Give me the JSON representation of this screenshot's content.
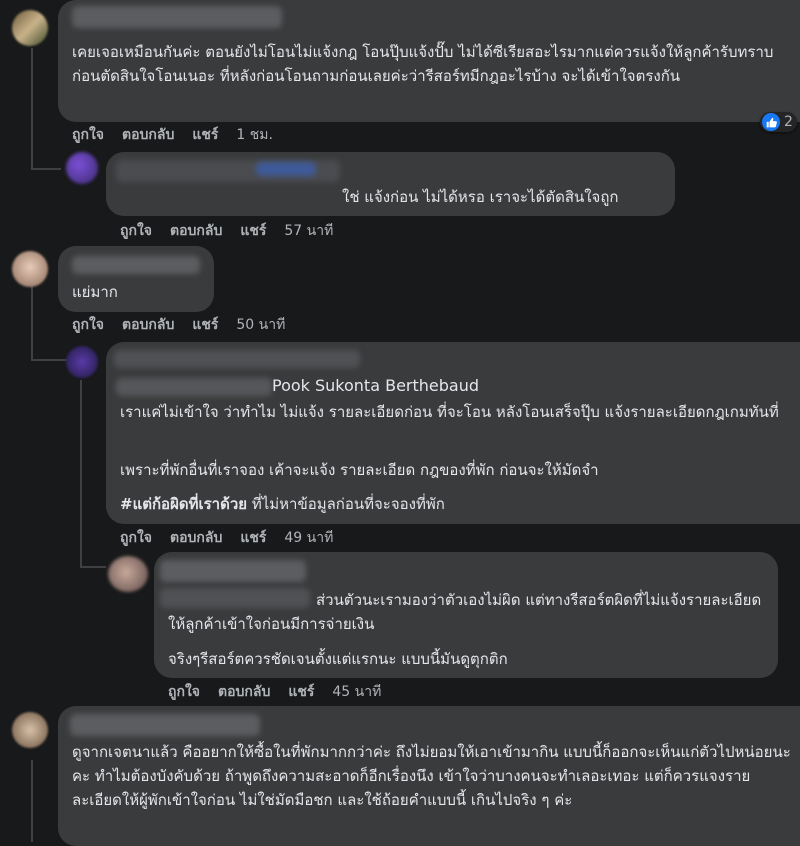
{
  "actions": {
    "like": "ถูกใจ",
    "reply": "ตอบกลับ",
    "share": "แชร์"
  },
  "comments": [
    {
      "text": "เคยเจอเหมือนกันค่ะ ตอนยังไม่โอนไม่แจ้งกฎ โอนปุ๊บแจ้งปั๊บ ไม่ได้ซีเรียสอะไรมากแต่ควรแจ้งให้ลูกค้ารับทราบก่อนตัดสินใจโอนเนอะ ที่หลังก่อนโอนถามก่อนเลยค่ะว่ารีสอร์ทมีกฎอะไรบ้าง จะได้เข้าใจตรงกัน",
      "time": "1 ชม.",
      "reaction_count": "2"
    },
    {
      "text": "ใช่ แจ้งก่อน ไม่ได้หรอ เราจะได้ตัดสินใจถูก",
      "time": "57 นาที"
    },
    {
      "text": "แย่มาก",
      "time": "50 นาที"
    },
    {
      "mention": "Pook Sukonta Berthebaud",
      "paragraph1": "เราแค่ไม่เข้าใจ ว่าทำไม ไม่แจ้ง รายละเอียดก่อน ที่จะโอน หลังโอนเสร็จปุ๊บ แจ้งรายละเอียดกฎเกมทันที่",
      "paragraph2": "เพราะที่พักอื่นที่เราจอง เค้าจะแจ้ง รายละเอียด กฎของที่พัก ก่อนจะให้มัดจำ",
      "hashtag": "#แต่ก้อผิดที่เราด้วย",
      "paragraph3_rest": " ที่ไม่หาข้อมูลก่อนที่จะจองที่พัก",
      "time": "49 นาที"
    },
    {
      "paragraph1": "ส่วนตัวนะเรามองว่าตัวเองไม่ผิด แต่ทางรีสอร์ตผิดที่ไม่แจ้งรายละเอียดให้ลูกค้าเข้าใจก่อนมีการจ่ายเงิน",
      "paragraph2": "จริงๆรีสอร์ตควรชัดเจนตั้งแต่แรกนะ แบบนี้มันดูตุกติก",
      "time": "45 นาที"
    },
    {
      "text": "ดูจากเจตนาแล้ว คืออยากให้ซื้อในที่พักมากกว่าค่ะ ถึงไม่ยอมให้เอาเข้ามากิน แบบนี้ก็ออกจะเห็นแก่ตัวไปหน่อยนะคะ ทำไมต้องบังคับด้วย ถ้าพูดถึงความสะอาดก็อีกเรื่องนึง เข้าใจว่าบางคนจะทำเลอะเทอะ แต่ก็ควรแจงรายละเอียดให้ผู้พักเข้าใจก่อน ไม่ใช่มัดมือชก และใช้ถ้อยคำแบบนี้ เกินไปจริง ๆ ค่ะ"
    }
  ],
  "colors": {
    "background": "#18191a",
    "bubble": "#3a3b3c",
    "text": "#e4e6eb",
    "secondary_text": "#b0b3b8",
    "like_blue": "#1877f2"
  }
}
